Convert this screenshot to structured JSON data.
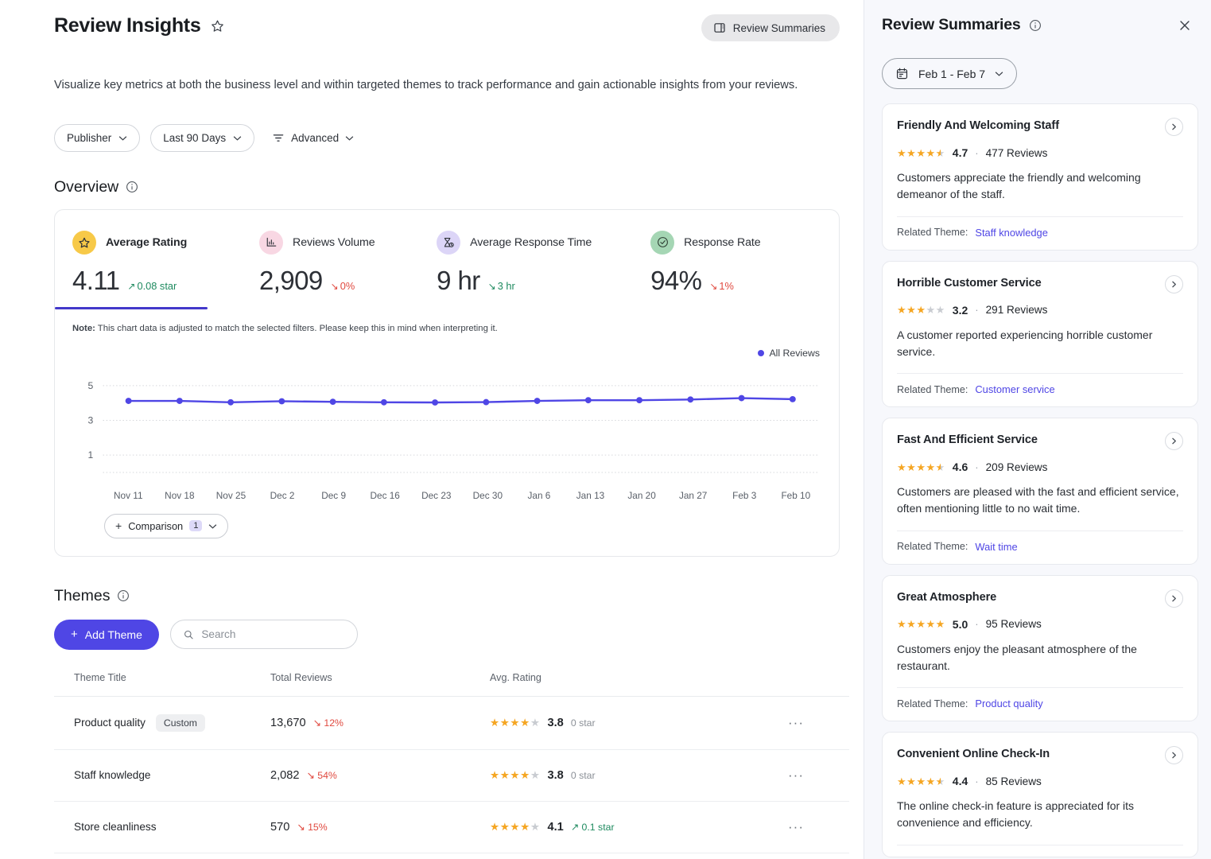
{
  "header": {
    "title": "Review Insights",
    "favorite_icon": "star-outline-icon",
    "review_summaries_button": "Review Summaries"
  },
  "subtitle": "Visualize key metrics at both the business level and within targeted themes to track performance and gain actionable insights from your reviews.",
  "filters": [
    {
      "label": "Publisher",
      "type": "dropdown"
    },
    {
      "label": "Last 90 Days",
      "type": "dropdown"
    },
    {
      "label": "Advanced",
      "type": "advanced"
    }
  ],
  "overview": {
    "section_title": "Overview",
    "metrics": [
      {
        "label": "Average Rating",
        "value": "4.11",
        "delta": "0.08 star",
        "direction": "up",
        "tone": "positive",
        "icon": "star-icon",
        "icon_bg": "#f7c948",
        "icon_color": "#2b2f36",
        "active": true
      },
      {
        "label": "Reviews Volume",
        "value": "2,909",
        "delta": "0%",
        "direction": "down",
        "tone": "negative",
        "icon": "bar-chart-icon",
        "icon_bg": "#f8d7e3",
        "icon_color": "#2b2f36",
        "active": false
      },
      {
        "label": "Average Response Time",
        "value": "9 hr",
        "delta": "3 hr",
        "direction": "down",
        "tone": "positive",
        "icon": "hourglass-clock-icon",
        "icon_bg": "#dcd5f7",
        "icon_color": "#2b2f36",
        "active": false
      },
      {
        "label": "Response Rate",
        "value": "94%",
        "delta": "1%",
        "direction": "down",
        "tone": "negative",
        "icon": "check-circle-icon",
        "icon_bg": "#a5d6b4",
        "icon_color": "#2b2f36",
        "active": false
      }
    ],
    "note_prefix": "Note:",
    "note": " This chart data is adjusted to match the selected filters. Please keep this in mind when interpreting it.",
    "comparison": {
      "label": "Comparison",
      "count": "1"
    }
  },
  "chart_data": {
    "type": "line",
    "title": "",
    "xlabel": "",
    "ylabel": "",
    "legend": [
      {
        "name": "All Reviews",
        "color": "#4f46e5"
      }
    ],
    "legend_position": "top-right",
    "grid": true,
    "ylim": [
      0,
      6
    ],
    "yticks": [
      1,
      3,
      5
    ],
    "categories": [
      "Nov 11",
      "Nov 18",
      "Nov 25",
      "Dec 2",
      "Dec 9",
      "Dec 16",
      "Dec 23",
      "Dec 30",
      "Jan 6",
      "Jan 13",
      "Jan 20",
      "Jan 27",
      "Feb 3",
      "Feb 10"
    ],
    "series": [
      {
        "name": "All Reviews",
        "color": "#4f46e5",
        "values": [
          4.12,
          4.12,
          4.04,
          4.1,
          4.07,
          4.04,
          4.03,
          4.05,
          4.12,
          4.16,
          4.16,
          4.2,
          4.28,
          4.22
        ]
      }
    ]
  },
  "themes": {
    "section_title": "Themes",
    "add_button": "Add Theme",
    "search_placeholder": "Search",
    "search_value": "",
    "columns": [
      "Theme Title",
      "Total Reviews",
      "Avg. Rating",
      ""
    ],
    "rows": [
      {
        "title": "Product quality",
        "badge": "Custom",
        "total_reviews": "13,670",
        "reviews_delta": "12%",
        "reviews_direction": "down",
        "stars_filled": 4,
        "rating": "3.8",
        "rating_delta": "0 star",
        "rating_direction": "none"
      },
      {
        "title": "Staff knowledge",
        "badge": "",
        "total_reviews": "2,082",
        "reviews_delta": "54%",
        "reviews_direction": "down",
        "stars_filled": 4,
        "rating": "3.8",
        "rating_delta": "0 star",
        "rating_direction": "none"
      },
      {
        "title": "Store cleanliness",
        "badge": "",
        "total_reviews": "570",
        "reviews_delta": "15%",
        "reviews_direction": "down",
        "stars_filled": 4,
        "rating": "4.1",
        "rating_delta": "0.1 star",
        "rating_direction": "up"
      }
    ],
    "more_icon": "ellipsis-icon"
  },
  "panel": {
    "title": "Review Summaries",
    "info_icon": "info-icon",
    "close_icon": "close-icon",
    "date_range": "Feb 1 - Feb 7",
    "calendar_icon": "calendar-icon",
    "related_theme_label": "Related Theme:",
    "cards": [
      {
        "title": "Friendly And Welcoming Staff",
        "score": "4.7",
        "separator": "·",
        "reviews": "477 Reviews",
        "stars_full": 4,
        "stars_half": 1,
        "text": "Customers appreciate the friendly and welcoming demeanor of the staff.",
        "theme": "Staff knowledge"
      },
      {
        "title": "Horrible Customer Service",
        "score": "3.2",
        "separator": "·",
        "reviews": "291 Reviews",
        "stars_full": 3,
        "stars_half": 0,
        "text": "A customer reported experiencing horrible customer service.",
        "theme": "Customer service"
      },
      {
        "title": "Fast And Efficient Service",
        "score": "4.6",
        "separator": "·",
        "reviews": "209 Reviews",
        "stars_full": 4,
        "stars_half": 1,
        "text": "Customers are pleased with the fast and efficient service, often mentioning little to no wait time.",
        "theme": "Wait time"
      },
      {
        "title": "Great Atmosphere",
        "score": "5.0",
        "separator": "·",
        "reviews": "95 Reviews",
        "stars_full": 5,
        "stars_half": 0,
        "text": "Customers enjoy the pleasant atmosphere of the restaurant.",
        "theme": "Product quality"
      },
      {
        "title": "Convenient Online Check-In",
        "score": "4.4",
        "separator": "·",
        "reviews": "85 Reviews",
        "stars_full": 4,
        "stars_half": 1,
        "text": "The online check-in feature is appreciated for its convenience and efficiency.",
        "theme": ""
      }
    ]
  },
  "colors": {
    "accent": "#4f46e5",
    "positive": "#1e8a5f",
    "negative": "#e0493f",
    "star": "#f5a623"
  }
}
